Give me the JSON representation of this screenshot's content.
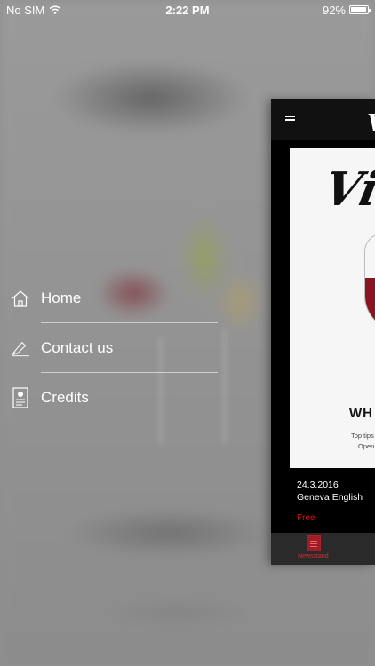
{
  "status_bar": {
    "carrier": "No SIM",
    "time": "2:22 PM",
    "battery_text": "92%",
    "battery_level": 0.92,
    "wifi_icon": "wifi-icon",
    "battery_icon": "battery-icon"
  },
  "menu": {
    "items": [
      {
        "label": "Home",
        "icon": "home-icon"
      },
      {
        "label": "Contact us",
        "icon": "pen-icon"
      },
      {
        "label": "Credits",
        "icon": "badge-icon"
      }
    ]
  },
  "card": {
    "nav_logo": "Vi",
    "cover": {
      "logo": "Vi",
      "heading": "WH",
      "subtitle_line1": "Top tips",
      "subtitle_line2": "Open"
    },
    "issue": {
      "date": "24.3.2016",
      "title": "Geneva English",
      "price": "Free"
    },
    "tab": {
      "label": "Newsstand",
      "icon": "newsstand-icon"
    }
  },
  "colors": {
    "accent_red": "#d11111",
    "wine": "#8a1420",
    "card_bg": "#1b1b1b"
  }
}
